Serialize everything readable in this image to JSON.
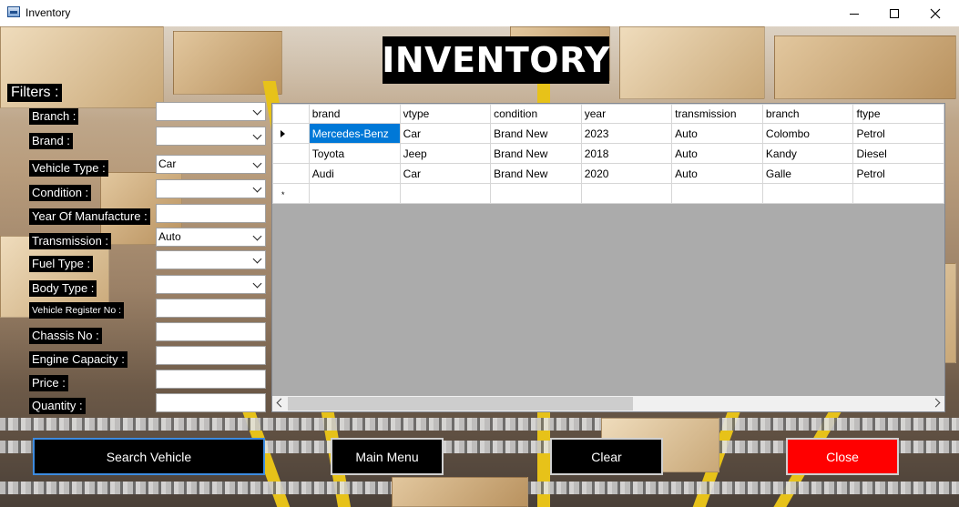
{
  "window": {
    "title": "Inventory"
  },
  "heading": "INVENTORY",
  "filters": {
    "title": "Filters :",
    "fields": [
      {
        "label": "Branch :",
        "kind": "combo",
        "value": ""
      },
      {
        "label": "Brand :",
        "kind": "combo",
        "value": ""
      },
      {
        "label": "Vehicle Type :",
        "kind": "combo",
        "value": "Car"
      },
      {
        "label": "Condition :",
        "kind": "combo",
        "value": ""
      },
      {
        "label": "Year Of Manufacture :",
        "kind": "text",
        "value": ""
      },
      {
        "label": "Transmission :",
        "kind": "combo",
        "value": "Auto"
      },
      {
        "label": "Fuel Type :",
        "kind": "combo",
        "value": ""
      },
      {
        "label": "Body Type :",
        "kind": "combo",
        "value": ""
      },
      {
        "label": "Vehicle Register No :",
        "kind": "text",
        "value": ""
      },
      {
        "label": "Chassis No :",
        "kind": "text",
        "value": ""
      },
      {
        "label": "Engine Capacity :",
        "kind": "text",
        "value": ""
      },
      {
        "label": "Price :",
        "kind": "text",
        "value": ""
      },
      {
        "label": "Quantity :",
        "kind": "text",
        "value": ""
      }
    ]
  },
  "grid": {
    "columns": [
      "brand",
      "vtype",
      "condition",
      "year",
      "transmission",
      "branch",
      "ftype"
    ],
    "rows": [
      [
        "Mercedes-Benz",
        "Car",
        "Brand New",
        "2023",
        "Auto",
        "Colombo",
        "Petrol"
      ],
      [
        "Toyota",
        "Jeep",
        "Brand New",
        "2018",
        "Auto",
        "Kandy",
        "Diesel"
      ],
      [
        "Audi",
        "Car",
        "Brand New",
        "2020",
        "Auto",
        "Galle",
        "Petrol"
      ]
    ],
    "new_row_marker": "*"
  },
  "buttons": {
    "search": "Search Vehicle",
    "main_menu": "Main Menu",
    "clear": "Clear",
    "close": "Close"
  },
  "colors": {
    "selection": "#0078d7",
    "close_button": "#ff0000",
    "search_border": "#3d8be0"
  }
}
